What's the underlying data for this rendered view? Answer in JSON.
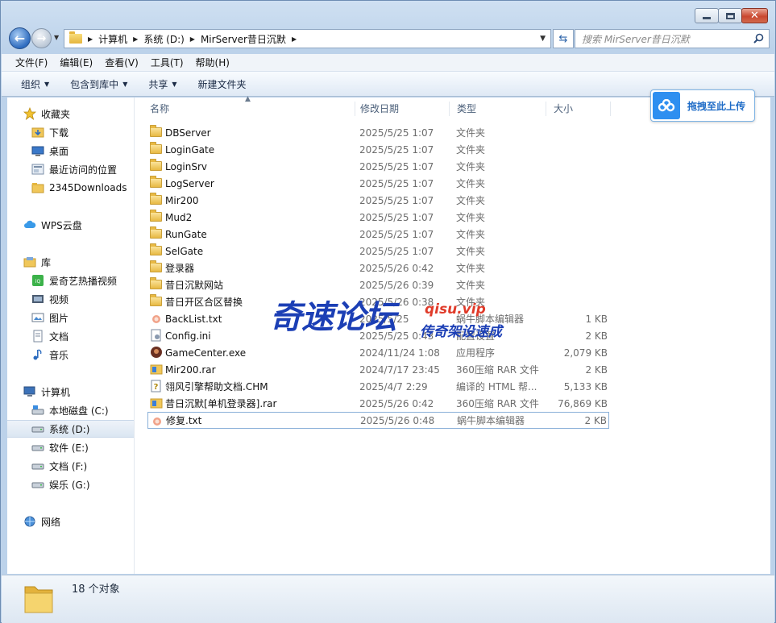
{
  "address": {
    "crumbs": [
      "计算机",
      "系统 (D:)",
      "MirServer昔日沉默"
    ],
    "search_placeholder": "搜索 MirServer昔日沉默"
  },
  "menubar": [
    "文件(F)",
    "编辑(E)",
    "查看(V)",
    "工具(T)",
    "帮助(H)"
  ],
  "commandbar": {
    "organize": "组织",
    "include_library": "包含到库中",
    "share": "共享",
    "new_folder": "新建文件夹"
  },
  "navpane": {
    "favorites": "收藏夹",
    "fav_items": [
      "下载",
      "桌面",
      "最近访问的位置",
      "2345Downloads"
    ],
    "wps_cloud": "WPS云盘",
    "libraries": "库",
    "lib_items": [
      "爱奇艺热播视频",
      "视频",
      "图片",
      "文档",
      "音乐"
    ],
    "computer": "计算机",
    "drives": [
      "本地磁盘 (C:)",
      "系统 (D:)",
      "软件 (E:)",
      "文档 (F:)",
      "娱乐 (G:)"
    ],
    "network": "网络"
  },
  "columns": {
    "name": "名称",
    "date": "修改日期",
    "type": "类型",
    "size": "大小"
  },
  "files": [
    {
      "name": "DBServer",
      "date": "2025/5/25 1:07",
      "type": "文件夹",
      "size": "",
      "icon": "folder"
    },
    {
      "name": "LoginGate",
      "date": "2025/5/25 1:07",
      "type": "文件夹",
      "size": "",
      "icon": "folder"
    },
    {
      "name": "LoginSrv",
      "date": "2025/5/25 1:07",
      "type": "文件夹",
      "size": "",
      "icon": "folder"
    },
    {
      "name": "LogServer",
      "date": "2025/5/25 1:07",
      "type": "文件夹",
      "size": "",
      "icon": "folder"
    },
    {
      "name": "Mir200",
      "date": "2025/5/25 1:07",
      "type": "文件夹",
      "size": "",
      "icon": "folder"
    },
    {
      "name": "Mud2",
      "date": "2025/5/25 1:07",
      "type": "文件夹",
      "size": "",
      "icon": "folder"
    },
    {
      "name": "RunGate",
      "date": "2025/5/25 1:07",
      "type": "文件夹",
      "size": "",
      "icon": "folder"
    },
    {
      "name": "SelGate",
      "date": "2025/5/25 1:07",
      "type": "文件夹",
      "size": "",
      "icon": "folder"
    },
    {
      "name": "登录器",
      "date": "2025/5/26 0:42",
      "type": "文件夹",
      "size": "",
      "icon": "folder"
    },
    {
      "name": "昔日沉默网站",
      "date": "2025/5/26 0:39",
      "type": "文件夹",
      "size": "",
      "icon": "folder"
    },
    {
      "name": "昔日开区合区替换",
      "date": "2025/5/26 0:38",
      "type": "文件夹",
      "size": "",
      "icon": "folder"
    },
    {
      "name": "BackList.txt",
      "date": "2025/5/25",
      "type": "蜗牛脚本编辑器",
      "size": "1 KB",
      "icon": "snail"
    },
    {
      "name": "Config.ini",
      "date": "2025/5/25 0:43",
      "type": "配置设置",
      "size": "2 KB",
      "icon": "ini"
    },
    {
      "name": "GameCenter.exe",
      "date": "2024/11/24 1:08",
      "type": "应用程序",
      "size": "2,079 KB",
      "icon": "exe"
    },
    {
      "name": "Mir200.rar",
      "date": "2024/7/17 23:45",
      "type": "360压缩 RAR 文件",
      "size": "2 KB",
      "icon": "rar"
    },
    {
      "name": "翎风引擎帮助文档.CHM",
      "date": "2025/4/7 2:29",
      "type": "编译的 HTML 帮...",
      "size": "5,133 KB",
      "icon": "chm"
    },
    {
      "name": "昔日沉默[单机登录器].rar",
      "date": "2025/5/26 0:42",
      "type": "360压缩 RAR 文件",
      "size": "76,869 KB",
      "icon": "rar"
    },
    {
      "name": "修复.txt",
      "date": "2025/5/26 0:48",
      "type": "蜗牛脚本编辑器",
      "size": "2 KB",
      "icon": "snail"
    }
  ],
  "upload_button": "拖拽至此上传",
  "watermark": {
    "main": "奇速论坛",
    "url": "qisu.vip",
    "sub": "传奇架设速成"
  },
  "status": "18 个对象"
}
